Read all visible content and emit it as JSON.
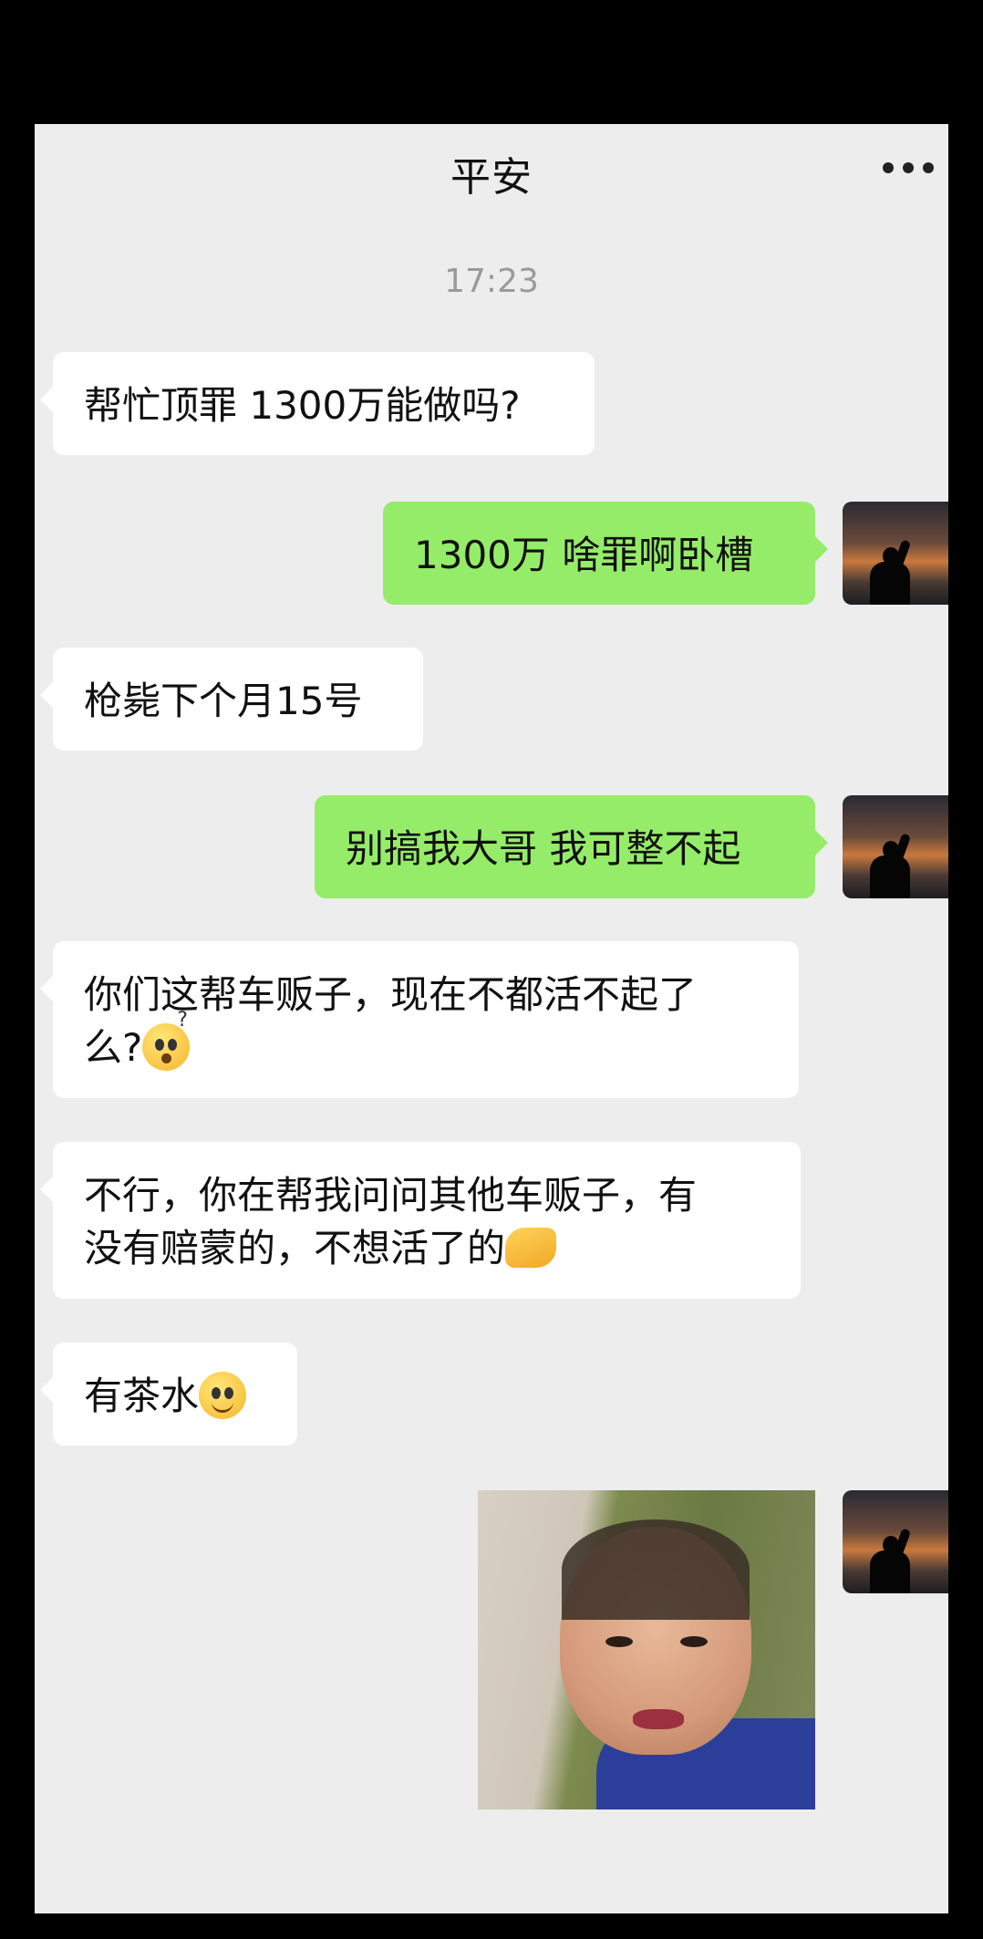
{
  "header": {
    "title": "平安",
    "more_icon": "more-dots-icon"
  },
  "timestamp": "17:23",
  "messages": [
    {
      "side": "left",
      "text": "帮忙顶罪 1300万能做吗?"
    },
    {
      "side": "right",
      "text": "1300万 啥罪啊卧槽"
    },
    {
      "side": "left",
      "text": "枪毙下个月15号"
    },
    {
      "side": "right",
      "text": "别搞我大哥 我可整不起"
    },
    {
      "side": "left",
      "text_line1": "你们这帮车贩子，现在不都活不起了",
      "text_line2": "么?",
      "emoji": "thinking-face-emoji"
    },
    {
      "side": "left",
      "text_line1": "不行，你在帮我问问其他车贩子，有",
      "text_line2": "没有赔蒙的，不想活了的",
      "emoji": "handshake-emoji"
    },
    {
      "side": "left",
      "text": "有茶水",
      "emoji": "smiling-face-emoji"
    },
    {
      "side": "right",
      "type": "image",
      "emoji": "meme-photo"
    }
  ],
  "colors": {
    "bg": "#ededed",
    "left_bubble": "#ffffff",
    "right_bubble": "#95ec69"
  }
}
